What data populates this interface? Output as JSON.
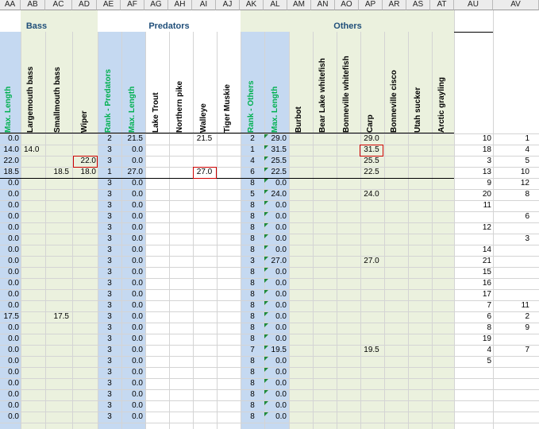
{
  "columns": [
    "AA",
    "AB",
    "AC",
    "AD",
    "AE",
    "AF",
    "AG",
    "AH",
    "AI",
    "AJ",
    "AK",
    "AL",
    "AM",
    "AN",
    "AO",
    "AP",
    "AR",
    "AS",
    "AT",
    "AU",
    "AV"
  ],
  "groups": {
    "bass": "Bass",
    "predators": "Predators",
    "others": "Others"
  },
  "headers": {
    "aa": "Max. Length",
    "ab": "Largemouth bass",
    "ac": "Smallmouth bass",
    "ad": "Wiper",
    "ae": "Rank - Predators",
    "af": "Max. Length",
    "ag": "Lake Trout",
    "ah": "Northern pike",
    "ai": "Walleye",
    "aj": "Tiger Muskie",
    "ak": "Rank - Others",
    "al": "Max. Length",
    "am": "Burbot",
    "an": "Bear Lake whitefish",
    "ao": "Bonneville whitefish",
    "ap": "Carp",
    "ar": "Bonneville cisco",
    "as": "Utah sucker",
    "at": "Arctic grayling"
  },
  "colors": {
    "blue_fill": "#c5d9f1",
    "green_fill": "#ebf1de",
    "green_text": "#00b050",
    "title_blue": "#1f4e79",
    "error_red": "#cc0000"
  },
  "rows": [
    {
      "aa": "0.0",
      "ab": "",
      "ac": "",
      "ad": "",
      "ae": "2",
      "af": "21.5",
      "ai": "21.5",
      "ak": "2",
      "al": "29.0",
      "ap": "29.0",
      "au": "10",
      "av": "1"
    },
    {
      "aa": "14.0",
      "ab": "14.0",
      "ac": "",
      "ad": "",
      "ae": "3",
      "af": "0.0",
      "ai": "",
      "ak": "1",
      "al": "31.5",
      "ap": "31.5",
      "au": "18",
      "av": "4"
    },
    {
      "aa": "22.0",
      "ab": "",
      "ac": "",
      "ad": "22.0",
      "ae": "3",
      "af": "0.0",
      "ai": "",
      "ak": "4",
      "al": "25.5",
      "ap": "25.5",
      "au": "3",
      "av": "5"
    },
    {
      "aa": "18.5",
      "ab": "",
      "ac": "18.5",
      "ad": "18.0",
      "ae": "1",
      "af": "27.0",
      "ai": "27.0",
      "ak": "6",
      "al": "22.5",
      "ap": "22.5",
      "au": "13",
      "av": "10"
    },
    {
      "aa": "0.0",
      "ab": "",
      "ac": "",
      "ad": "",
      "ae": "3",
      "af": "0.0",
      "ai": "",
      "ak": "8",
      "al": "0.0",
      "ap": "",
      "au": "9",
      "av": "12"
    },
    {
      "aa": "0.0",
      "ab": "",
      "ac": "",
      "ad": "",
      "ae": "3",
      "af": "0.0",
      "ai": "",
      "ak": "5",
      "al": "24.0",
      "ap": "24.0",
      "au": "20",
      "av": "8"
    },
    {
      "aa": "0.0",
      "ab": "",
      "ac": "",
      "ad": "",
      "ae": "3",
      "af": "0.0",
      "ai": "",
      "ak": "8",
      "al": "0.0",
      "ap": "",
      "au": "11",
      "av": ""
    },
    {
      "aa": "0.0",
      "ab": "",
      "ac": "",
      "ad": "",
      "ae": "3",
      "af": "0.0",
      "ai": "",
      "ak": "8",
      "al": "0.0",
      "ap": "",
      "au": "",
      "av": "6"
    },
    {
      "aa": "0.0",
      "ab": "",
      "ac": "",
      "ad": "",
      "ae": "3",
      "af": "0.0",
      "ai": "",
      "ak": "8",
      "al": "0.0",
      "ap": "",
      "au": "12",
      "av": ""
    },
    {
      "aa": "0.0",
      "ab": "",
      "ac": "",
      "ad": "",
      "ae": "3",
      "af": "0.0",
      "ai": "",
      "ak": "8",
      "al": "0.0",
      "ap": "",
      "au": "",
      "av": "3"
    },
    {
      "aa": "0.0",
      "ab": "",
      "ac": "",
      "ad": "",
      "ae": "3",
      "af": "0.0",
      "ai": "",
      "ak": "8",
      "al": "0.0",
      "ap": "",
      "au": "14",
      "av": ""
    },
    {
      "aa": "0.0",
      "ab": "",
      "ac": "",
      "ad": "",
      "ae": "3",
      "af": "0.0",
      "ai": "",
      "ak": "3",
      "al": "27.0",
      "ap": "27.0",
      "au": "21",
      "av": ""
    },
    {
      "aa": "0.0",
      "ab": "",
      "ac": "",
      "ad": "",
      "ae": "3",
      "af": "0.0",
      "ai": "",
      "ak": "8",
      "al": "0.0",
      "ap": "",
      "au": "15",
      "av": ""
    },
    {
      "aa": "0.0",
      "ab": "",
      "ac": "",
      "ad": "",
      "ae": "3",
      "af": "0.0",
      "ai": "",
      "ak": "8",
      "al": "0.0",
      "ap": "",
      "au": "16",
      "av": ""
    },
    {
      "aa": "0.0",
      "ab": "",
      "ac": "",
      "ad": "",
      "ae": "3",
      "af": "0.0",
      "ai": "",
      "ak": "8",
      "al": "0.0",
      "ap": "",
      "au": "17",
      "av": ""
    },
    {
      "aa": "0.0",
      "ab": "",
      "ac": "",
      "ad": "",
      "ae": "3",
      "af": "0.0",
      "ai": "",
      "ak": "8",
      "al": "0.0",
      "ap": "",
      "au": "7",
      "av": "11"
    },
    {
      "aa": "17.5",
      "ab": "",
      "ac": "17.5",
      "ad": "",
      "ae": "3",
      "af": "0.0",
      "ai": "",
      "ak": "8",
      "al": "0.0",
      "ap": "",
      "au": "6",
      "av": "2"
    },
    {
      "aa": "0.0",
      "ab": "",
      "ac": "",
      "ad": "",
      "ae": "3",
      "af": "0.0",
      "ai": "",
      "ak": "8",
      "al": "0.0",
      "ap": "",
      "au": "8",
      "av": "9"
    },
    {
      "aa": "0.0",
      "ab": "",
      "ac": "",
      "ad": "",
      "ae": "3",
      "af": "0.0",
      "ai": "",
      "ak": "8",
      "al": "0.0",
      "ap": "",
      "au": "19",
      "av": ""
    },
    {
      "aa": "0.0",
      "ab": "",
      "ac": "",
      "ad": "",
      "ae": "3",
      "af": "0.0",
      "ai": "",
      "ak": "7",
      "al": "19.5",
      "ap": "19.5",
      "au": "4",
      "av": "7"
    },
    {
      "aa": "0.0",
      "ab": "",
      "ac": "",
      "ad": "",
      "ae": "3",
      "af": "0.0",
      "ai": "",
      "ak": "8",
      "al": "0.0",
      "ap": "",
      "au": "5",
      "av": ""
    },
    {
      "aa": "0.0",
      "ab": "",
      "ac": "",
      "ad": "",
      "ae": "3",
      "af": "0.0",
      "ai": "",
      "ak": "8",
      "al": "0.0",
      "ap": "",
      "au": "",
      "av": ""
    },
    {
      "aa": "0.0",
      "ab": "",
      "ac": "",
      "ad": "",
      "ae": "3",
      "af": "0.0",
      "ai": "",
      "ak": "8",
      "al": "0.0",
      "ap": "",
      "au": "",
      "av": ""
    },
    {
      "aa": "0.0",
      "ab": "",
      "ac": "",
      "ad": "",
      "ae": "3",
      "af": "0.0",
      "ai": "",
      "ak": "8",
      "al": "0.0",
      "ap": "",
      "au": "",
      "av": ""
    },
    {
      "aa": "0.0",
      "ab": "",
      "ac": "",
      "ad": "",
      "ae": "3",
      "af": "0.0",
      "ai": "",
      "ak": "8",
      "al": "0.0",
      "ap": "",
      "au": "",
      "av": ""
    },
    {
      "aa": "0.0",
      "ab": "",
      "ac": "",
      "ad": "",
      "ae": "3",
      "af": "0.0",
      "ai": "",
      "ak": "8",
      "al": "0.0",
      "ap": "",
      "au": "",
      "av": ""
    }
  ]
}
